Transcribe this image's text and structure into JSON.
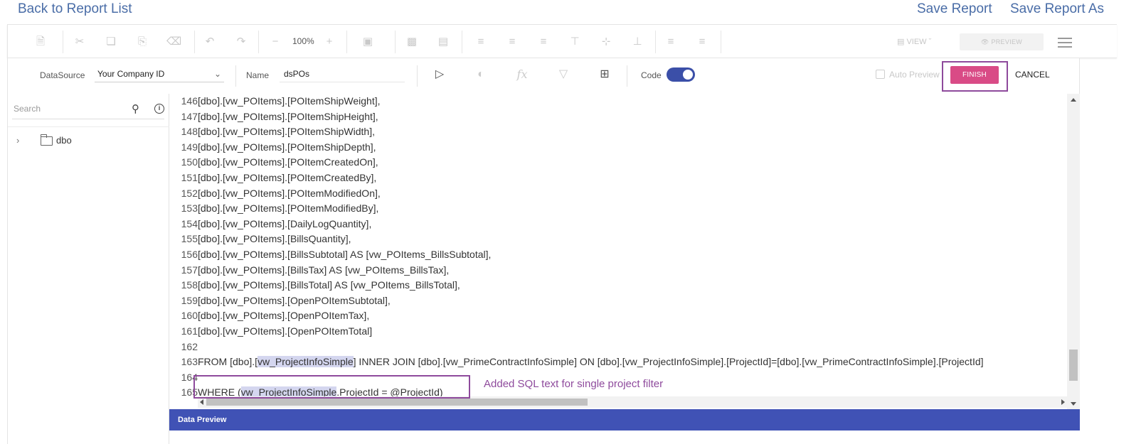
{
  "header": {
    "back_link": "Back to Report List",
    "save_report": "Save Report",
    "save_report_as": "Save Report As"
  },
  "toolbar": {
    "zoom": "100%",
    "view_label": "VIEW",
    "preview_label": "PREVIEW",
    "icons": [
      "new-file-icon",
      "cut-icon",
      "copy-icon",
      "paste-icon",
      "delete-icon",
      "undo-icon",
      "redo-icon",
      "zoom-out-icon",
      "zoom-in-icon",
      "group-icon",
      "align-icons",
      "menu-icon"
    ]
  },
  "datasource": {
    "label": "DataSource",
    "selected": "Your Company ID",
    "name_label": "Name",
    "name_value": "dsPOs",
    "code_label": "Code",
    "code_toggle_on": true,
    "auto_preview_label": "Auto Preview",
    "finish_label": "FINISH",
    "cancel_label": "CANCEL"
  },
  "sidebar": {
    "search_placeholder": "Search",
    "tree": [
      {
        "label": "dbo"
      }
    ]
  },
  "editor": {
    "lines": [
      {
        "n": "146",
        "text": "[dbo].[vw_POItems].[POItemShipWeight],"
      },
      {
        "n": "147",
        "text": "[dbo].[vw_POItems].[POItemShipHeight],"
      },
      {
        "n": "148",
        "text": "[dbo].[vw_POItems].[POItemShipWidth],"
      },
      {
        "n": "149",
        "text": "[dbo].[vw_POItems].[POItemShipDepth],"
      },
      {
        "n": "150",
        "text": "[dbo].[vw_POItems].[POItemCreatedOn],"
      },
      {
        "n": "151",
        "text": "[dbo].[vw_POItems].[POItemCreatedBy],"
      },
      {
        "n": "152",
        "text": "[dbo].[vw_POItems].[POItemModifiedOn],"
      },
      {
        "n": "153",
        "text": "[dbo].[vw_POItems].[POItemModifiedBy],"
      },
      {
        "n": "154",
        "text": "[dbo].[vw_POItems].[DailyLogQuantity],"
      },
      {
        "n": "155",
        "text": "[dbo].[vw_POItems].[BillsQuantity],"
      },
      {
        "n": "156",
        "text": "[dbo].[vw_POItems].[BillsSubtotal] AS [vw_POItems_BillsSubtotal],"
      },
      {
        "n": "157",
        "text": "[dbo].[vw_POItems].[BillsTax] AS [vw_POItems_BillsTax],"
      },
      {
        "n": "158",
        "text": "[dbo].[vw_POItems].[BillsTotal] AS [vw_POItems_BillsTotal],"
      },
      {
        "n": "159",
        "text": "[dbo].[vw_POItems].[OpenPOItemSubtotal],"
      },
      {
        "n": "160",
        "text": "[dbo].[vw_POItems].[OpenPOItemTax],"
      },
      {
        "n": "161",
        "text": "[dbo].[vw_POItems].[OpenPOItemTotal]"
      },
      {
        "n": "162",
        "text": ""
      },
      {
        "n": "163",
        "text_pre": "FROM [dbo].[",
        "text_hl": "vw_ProjectInfoSimple",
        "text_post": "] INNER JOIN [dbo].[vw_PrimeContractInfoSimple] ON [dbo].[vw_ProjectInfoSimple].[ProjectId]=[dbo].[vw_PrimeContractInfoSimple].[ProjectId]"
      },
      {
        "n": "164",
        "text": ""
      },
      {
        "n": "165",
        "text_pre": "WHERE (",
        "text_hl": "vw_ProjectInfoSimple",
        "text_post": ".ProjectId = @ProjectId)"
      }
    ],
    "annotation": "Added SQL text for single project filter"
  },
  "data_preview": {
    "label": "Data Preview"
  },
  "colors": {
    "link": "#4a6da7",
    "finish": "#d94b86",
    "toggle": "#3b4fa8",
    "annotation": "#8e4a9c",
    "preview_bar": "#4052b5"
  }
}
